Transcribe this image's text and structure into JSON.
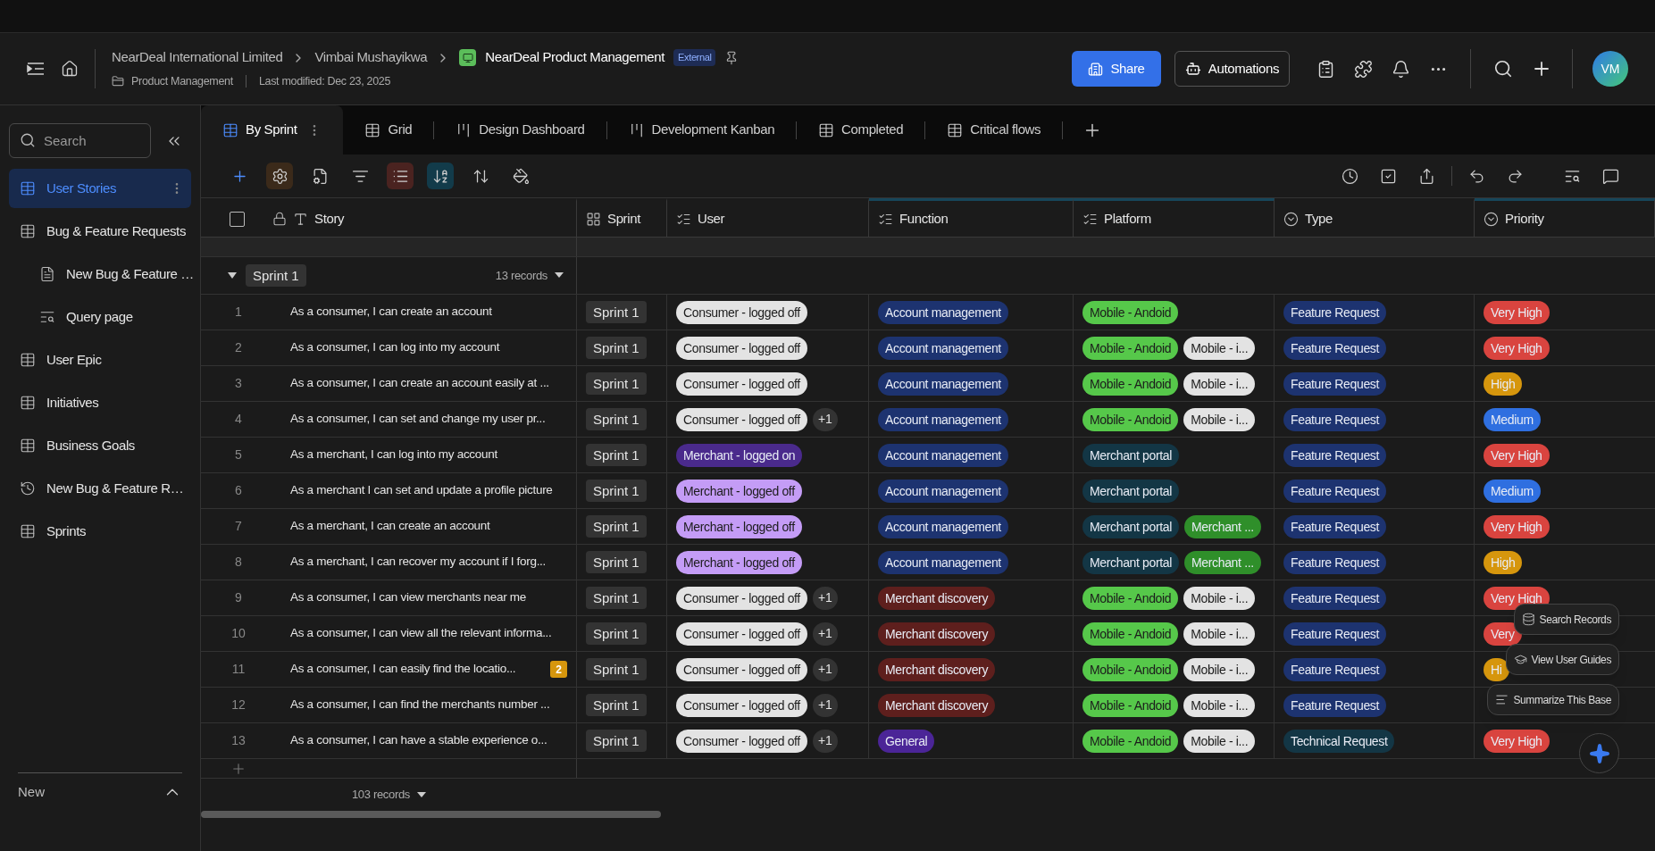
{
  "header": {
    "breadcrumbs": [
      "NearDeal International Limited",
      "Vimbai Mushayikwa"
    ],
    "base_title": "NearDeal Product Management",
    "badge": "External",
    "folder": "Product Management",
    "modified": "Last modified: Dec 23, 2025",
    "share_button": "Share",
    "automations_button": "Automations",
    "avatar": "VM"
  },
  "sidebar": {
    "search": {
      "placeholder": "Search"
    },
    "items": [
      {
        "label": "User Stories",
        "kind": "table",
        "selected": true
      },
      {
        "label": "Bug & Feature Requests",
        "kind": "table",
        "selected": false,
        "children": [
          {
            "label": "New Bug & Feature …",
            "kind": "form",
            "selected": false
          },
          {
            "label": "Query page",
            "kind": "query",
            "selected": false
          }
        ]
      },
      {
        "label": "User Epic",
        "kind": "table",
        "selected": false
      },
      {
        "label": "Initiatives",
        "kind": "table",
        "selected": false
      },
      {
        "label": "Business Goals",
        "kind": "table",
        "selected": false
      },
      {
        "label": "New Bug & Feature R…",
        "kind": "history",
        "selected": false
      },
      {
        "label": "Sprints",
        "kind": "table",
        "selected": false
      }
    ],
    "footer": "New"
  },
  "tabs": [
    {
      "label": "By Sprint",
      "kind": "grid",
      "selected": true
    },
    {
      "label": "Grid",
      "kind": "grid",
      "selected": false
    },
    {
      "label": "Design Dashboard",
      "kind": "kanban",
      "selected": false
    },
    {
      "label": "Development Kanban",
      "kind": "kanban",
      "selected": false
    },
    {
      "label": "Completed",
      "kind": "grid",
      "selected": false
    },
    {
      "label": "Critical flows",
      "kind": "grid",
      "selected": false
    }
  ],
  "toolbar": {
    "left": [
      {
        "kind": "add",
        "active": false
      },
      {
        "kind": "settings",
        "active": true
      },
      {
        "kind": "form",
        "active": false
      },
      {
        "kind": "filter",
        "active": false
      },
      {
        "kind": "list",
        "active": true
      },
      {
        "kind": "sort",
        "active": true
      },
      {
        "kind": "height",
        "active": false
      },
      {
        "kind": "paint",
        "active": false
      }
    ],
    "right": [
      {
        "kind": "history"
      },
      {
        "kind": "check"
      },
      {
        "kind": "share"
      },
      {
        "kind": "undo"
      },
      {
        "kind": "redo"
      },
      {
        "kind": "find"
      },
      {
        "kind": "comment"
      }
    ]
  },
  "table": {
    "columns": [
      {
        "label": "Story",
        "kind": "text",
        "highlighted": false
      },
      {
        "label": "Sprint",
        "kind": "link",
        "highlighted": false
      },
      {
        "label": "User",
        "kind": "multi",
        "highlighted": false
      },
      {
        "label": "Function",
        "kind": "multi",
        "highlighted": true
      },
      {
        "label": "Platform",
        "kind": "multi",
        "highlighted": true
      },
      {
        "label": "Type",
        "kind": "single",
        "highlighted": false
      },
      {
        "label": "Priority",
        "kind": "single",
        "highlighted": true
      }
    ],
    "select_all": {
      "checked": false
    },
    "group": {
      "label": "Sprint 1",
      "count": "13 records",
      "expanded": true
    },
    "rows": [
      {
        "number": "1",
        "story": "As a consumer, I can create an account",
        "sprint": "Sprint 1",
        "user": [
          {
            "label": "Consumer - logged off",
            "color": "#e3e3e3"
          }
        ],
        "function": [
          {
            "label": "Account management",
            "color": "#1d3370"
          }
        ],
        "platform": [
          {
            "label": "Mobile - Andoid",
            "color": "#56c84a"
          }
        ],
        "type": [
          {
            "label": "Feature Request",
            "color": "#1d3370"
          }
        ],
        "priority": [
          {
            "label": "Very High",
            "color": "#d9443f"
          }
        ]
      },
      {
        "number": "2",
        "story": "As a consumer, I can log into my account",
        "sprint": "Sprint 1",
        "user": [
          {
            "label": "Consumer - logged off",
            "color": "#e3e3e3"
          }
        ],
        "function": [
          {
            "label": "Account management",
            "color": "#1d3370"
          }
        ],
        "platform": [
          {
            "label": "Mobile - Andoid",
            "color": "#56c84a"
          },
          {
            "label": "Mobile - i...",
            "color": "#e3e3e3"
          }
        ],
        "type": [
          {
            "label": "Feature Request",
            "color": "#1d3370"
          }
        ],
        "priority": [
          {
            "label": "Very High",
            "color": "#d9443f"
          }
        ]
      },
      {
        "number": "3",
        "story": "As a consumer, I can create an account easily at ...",
        "sprint": "Sprint 1",
        "user": [
          {
            "label": "Consumer - logged off",
            "color": "#e3e3e3"
          }
        ],
        "function": [
          {
            "label": "Account management",
            "color": "#1d3370"
          }
        ],
        "platform": [
          {
            "label": "Mobile - Andoid",
            "color": "#56c84a"
          },
          {
            "label": "Mobile - i...",
            "color": "#e3e3e3"
          }
        ],
        "type": [
          {
            "label": "Feature Request",
            "color": "#1d3370"
          }
        ],
        "priority": [
          {
            "label": "High",
            "color": "#d6960d"
          }
        ]
      },
      {
        "number": "4",
        "story": "As a consumer, I can set and change my user pr...",
        "sprint": "Sprint 1",
        "user": [
          {
            "label": "Consumer - logged off",
            "color": "#e3e3e3"
          }
        ],
        "user_more": "+1",
        "function": [
          {
            "label": "Account management",
            "color": "#1d3370"
          }
        ],
        "platform": [
          {
            "label": "Mobile - Andoid",
            "color": "#56c84a"
          },
          {
            "label": "Mobile - i...",
            "color": "#e3e3e3"
          }
        ],
        "type": [
          {
            "label": "Feature Request",
            "color": "#1d3370"
          }
        ],
        "priority": [
          {
            "label": "Medium",
            "color": "#2f6fe0"
          }
        ]
      },
      {
        "number": "5",
        "story": "As a merchant, I can log into my account",
        "sprint": "Sprint 1",
        "user": [
          {
            "label": "Merchant - logged on",
            "color": "#4a2a8c"
          }
        ],
        "function": [
          {
            "label": "Account management",
            "color": "#1d3370"
          }
        ],
        "platform": [
          {
            "label": "Merchant portal",
            "color": "#133645"
          }
        ],
        "type": [
          {
            "label": "Feature Request",
            "color": "#1d3370"
          }
        ],
        "priority": [
          {
            "label": "Very High",
            "color": "#d9443f"
          }
        ]
      },
      {
        "number": "6",
        "story": "As a merchant I can set and update a profile picture",
        "sprint": "Sprint 1",
        "user": [
          {
            "label": "Merchant - logged off",
            "color": "#c49cf6"
          }
        ],
        "function": [
          {
            "label": "Account management",
            "color": "#1d3370"
          }
        ],
        "platform": [
          {
            "label": "Merchant portal",
            "color": "#133645"
          }
        ],
        "type": [
          {
            "label": "Feature Request",
            "color": "#1d3370"
          }
        ],
        "priority": [
          {
            "label": "Medium",
            "color": "#2f6fe0"
          }
        ]
      },
      {
        "number": "7",
        "story": "As a merchant, I can create an account",
        "sprint": "Sprint 1",
        "user": [
          {
            "label": "Merchant - logged off",
            "color": "#c49cf6"
          }
        ],
        "function": [
          {
            "label": "Account management",
            "color": "#1d3370"
          }
        ],
        "platform": [
          {
            "label": "Merchant portal",
            "color": "#133645"
          },
          {
            "label": "Merchant ...",
            "color": "#2f8f2a"
          }
        ],
        "type": [
          {
            "label": "Feature Request",
            "color": "#1d3370"
          }
        ],
        "priority": [
          {
            "label": "Very High",
            "color": "#d9443f"
          }
        ]
      },
      {
        "number": "8",
        "story": "As a merchant, I can recover my account if I forg...",
        "sprint": "Sprint 1",
        "user": [
          {
            "label": "Merchant - logged off",
            "color": "#c49cf6"
          }
        ],
        "function": [
          {
            "label": "Account management",
            "color": "#1d3370"
          }
        ],
        "platform": [
          {
            "label": "Merchant portal",
            "color": "#133645"
          },
          {
            "label": "Merchant ...",
            "color": "#2f8f2a"
          }
        ],
        "type": [
          {
            "label": "Feature Request",
            "color": "#1d3370"
          }
        ],
        "priority": [
          {
            "label": "High",
            "color": "#d6960d"
          }
        ]
      },
      {
        "number": "9",
        "story": "As a consumer, I can view merchants near me",
        "sprint": "Sprint 1",
        "user": [
          {
            "label": "Consumer - logged off",
            "color": "#e3e3e3"
          }
        ],
        "user_more": "+1",
        "function": [
          {
            "label": "Merchant discovery",
            "color": "#5e1f1d"
          }
        ],
        "platform": [
          {
            "label": "Mobile - Andoid",
            "color": "#56c84a"
          },
          {
            "label": "Mobile - i...",
            "color": "#e3e3e3"
          }
        ],
        "type": [
          {
            "label": "Feature Request",
            "color": "#1d3370"
          }
        ],
        "priority": [
          {
            "label": "Very High",
            "color": "#d9443f"
          }
        ]
      },
      {
        "number": "10",
        "story": "As a consumer, I can view all the relevant informa...",
        "sprint": "Sprint 1",
        "user": [
          {
            "label": "Consumer - logged off",
            "color": "#e3e3e3"
          }
        ],
        "user_more": "+1",
        "function": [
          {
            "label": "Merchant discovery",
            "color": "#5e1f1d"
          }
        ],
        "platform": [
          {
            "label": "Mobile - Andoid",
            "color": "#56c84a"
          },
          {
            "label": "Mobile - i...",
            "color": "#e3e3e3"
          }
        ],
        "type": [
          {
            "label": "Feature Request",
            "color": "#1d3370"
          }
        ],
        "priority": [
          {
            "label": "Very",
            "color": "#d9443f"
          }
        ]
      },
      {
        "number": "11",
        "story": "As a consumer, I can easily find the locatio...",
        "comments": "2",
        "sprint": "Sprint 1",
        "user": [
          {
            "label": "Consumer - logged off",
            "color": "#e3e3e3"
          }
        ],
        "user_more": "+1",
        "function": [
          {
            "label": "Merchant discovery",
            "color": "#5e1f1d"
          }
        ],
        "platform": [
          {
            "label": "Mobile - Andoid",
            "color": "#56c84a"
          },
          {
            "label": "Mobile - i...",
            "color": "#e3e3e3"
          }
        ],
        "type": [
          {
            "label": "Feature Request",
            "color": "#1d3370"
          }
        ],
        "priority": [
          {
            "label": "Hi",
            "color": "#d6960d"
          }
        ]
      },
      {
        "number": "12",
        "story": "As a consumer, I can find the merchants number ...",
        "sprint": "Sprint 1",
        "user": [
          {
            "label": "Consumer - logged off",
            "color": "#e3e3e3"
          }
        ],
        "user_more": "+1",
        "function": [
          {
            "label": "Merchant discovery",
            "color": "#5e1f1d"
          }
        ],
        "platform": [
          {
            "label": "Mobile - Andoid",
            "color": "#56c84a"
          },
          {
            "label": "Mobile - i...",
            "color": "#e3e3e3"
          }
        ],
        "type": [
          {
            "label": "Feature Request",
            "color": "#1d3370"
          }
        ]
      },
      {
        "number": "13",
        "story": "As a consumer, I can have a stable experience o...",
        "sprint": "Sprint 1",
        "user": [
          {
            "label": "Consumer - logged off",
            "color": "#e3e3e3"
          }
        ],
        "user_more": "+1",
        "function": [
          {
            "label": "General",
            "color": "#4b2597"
          }
        ],
        "platform": [
          {
            "label": "Mobile - Andoid",
            "color": "#56c84a"
          },
          {
            "label": "Mobile - i...",
            "color": "#e3e3e3"
          }
        ],
        "type": [
          {
            "label": "Technical Request",
            "color": "#133645"
          }
        ],
        "priority": [
          {
            "label": "Very High",
            "color": "#d9443f"
          }
        ]
      }
    ],
    "footer": "103 records"
  },
  "assistant": {
    "actions": [
      {
        "label": "Search Records",
        "kind": "search"
      },
      {
        "label": "View User Guides",
        "kind": "guide"
      },
      {
        "label": "Summarize This Base",
        "kind": "summary"
      }
    ]
  }
}
